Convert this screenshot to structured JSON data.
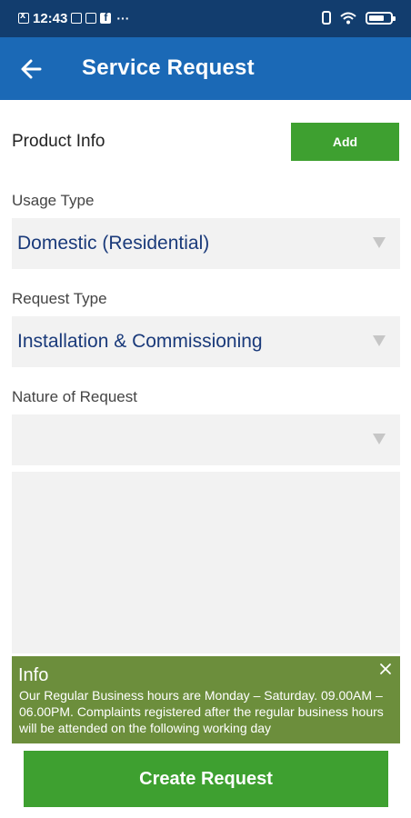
{
  "status_bar": {
    "time": "12:43",
    "more": "···"
  },
  "header": {
    "title": "Service Request"
  },
  "product_info": {
    "label": "Product Info",
    "add_label": "Add"
  },
  "usage_type": {
    "label": "Usage Type",
    "value": "Domestic (Residential)"
  },
  "request_type": {
    "label": "Request Type",
    "value": "Installation & Commissioning"
  },
  "nature_of_request": {
    "label": "Nature of Request",
    "value": ""
  },
  "info": {
    "title": "Info",
    "text": "Our Regular Business hours are Monday – Saturday. 09.00AM – 06.00PM. Complaints registered after the regular business hours will be attended on the following working day"
  },
  "footer": {
    "create_label": "Create Request"
  },
  "colors": {
    "status_bar": "#123d6e",
    "app_bar": "#1b69b6",
    "button_green": "#3ea030",
    "info_green": "#6c8e3c",
    "select_text": "#1a3a7a"
  }
}
